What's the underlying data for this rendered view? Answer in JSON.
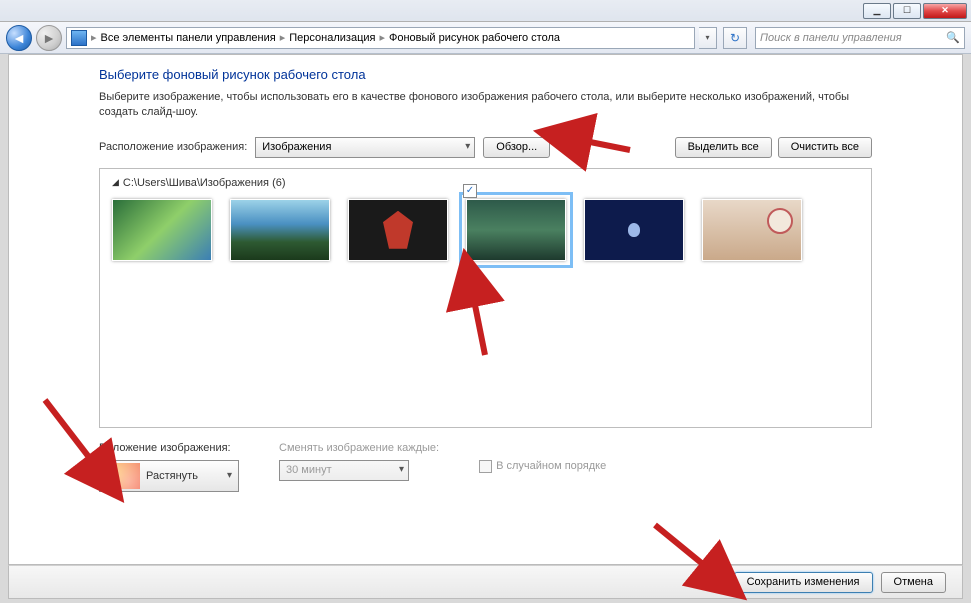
{
  "titlebar": {},
  "nav": {
    "breadcrumb": {
      "root": "Все элементы панели управления",
      "level1": "Персонализация",
      "level2": "Фоновый рисунок рабочего стола"
    },
    "search_placeholder": "Поиск в панели управления"
  },
  "main": {
    "heading": "Выберите фоновый рисунок рабочего стола",
    "description": "Выберите изображение, чтобы использовать его в качестве фонового изображения рабочего стола, или выберите несколько изображений, чтобы создать слайд-шоу.",
    "location_label": "Расположение изображения:",
    "location_value": "Изображения",
    "browse_label": "Обзор...",
    "select_all_label": "Выделить все",
    "clear_all_label": "Очистить все",
    "folder_path": "C:\\Users\\Шива\\Изображения (6)",
    "thumbnails": [
      {
        "id": "im1",
        "selected": false
      },
      {
        "id": "im2",
        "selected": false
      },
      {
        "id": "im3",
        "selected": false
      },
      {
        "id": "im4",
        "selected": true
      },
      {
        "id": "im5",
        "selected": false
      },
      {
        "id": "im6",
        "selected": false
      }
    ],
    "position": {
      "label": "Положение изображения:",
      "value": "Растянуть"
    },
    "interval": {
      "label": "Сменять изображение каждые:",
      "value": "30 минут"
    },
    "shuffle_label": "В случайном порядке"
  },
  "footer": {
    "save_label": "Сохранить изменения",
    "cancel_label": "Отмена"
  }
}
